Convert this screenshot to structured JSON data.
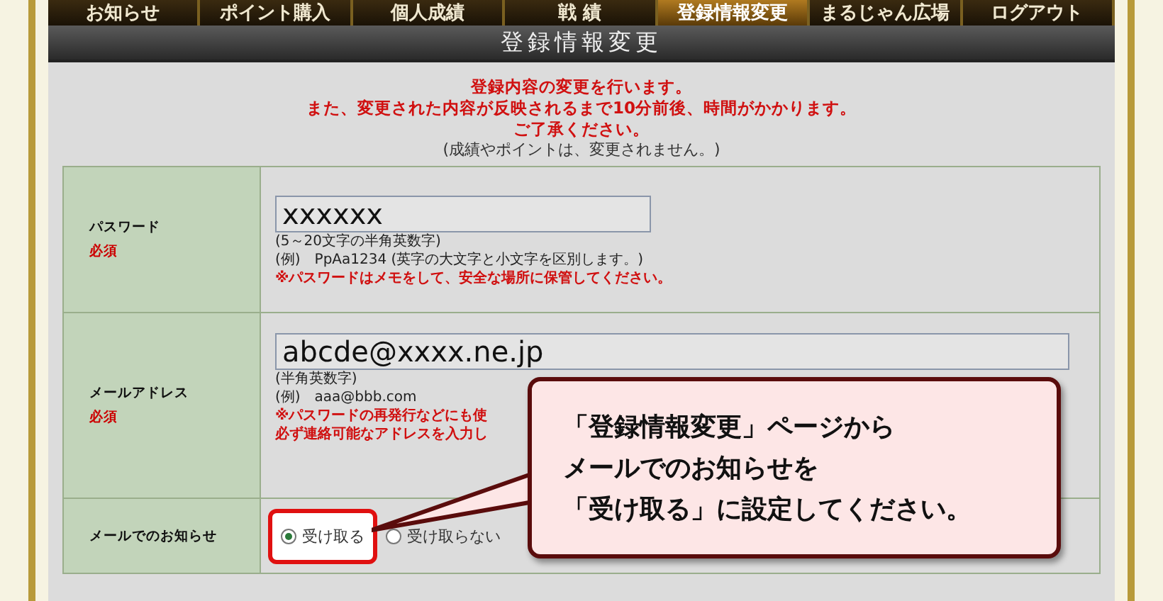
{
  "nav": [
    {
      "label": "お知らせ",
      "selected": false
    },
    {
      "label": "ポイント購入",
      "selected": false
    },
    {
      "label": "個人成績",
      "selected": false
    },
    {
      "label": "戦 績",
      "selected": false
    },
    {
      "label": "登録情報変更",
      "selected": true
    },
    {
      "label": "まるじゃん広場",
      "selected": false
    },
    {
      "label": "ログアウト",
      "selected": false
    }
  ],
  "page_title": "登録情報変更",
  "notice": {
    "lines": [
      "登録内容の変更を行います。",
      "また、変更された内容が反映されるまで10分前後、時間がかかります。",
      "ご了承ください。"
    ],
    "note": "(成績やポイントは、変更されません。)"
  },
  "form": [
    {
      "kind": "text",
      "label": "パスワード",
      "required": "必須",
      "value": "xxxxxx",
      "hints": [
        {
          "text": "(5～20文字の半角英数字)",
          "warning": false
        },
        {
          "text": "(例)　PpAa1234 (英字の大文字と小文字を区別します。)",
          "warning": false
        },
        {
          "text": "※パスワードはメモをして、安全な場所に保管してください。",
          "warning": true
        }
      ]
    },
    {
      "kind": "text",
      "label": "メールアドレス",
      "required": "必須",
      "value": "abcde@xxxx.ne.jp",
      "hints": [
        {
          "text": "(半角英数字)",
          "warning": false
        },
        {
          "text": "(例)　aaa@bbb.com",
          "warning": false
        },
        {
          "text": "※パスワードの再発行などにも使",
          "warning": true
        },
        {
          "text": "必ず連絡可能なアドレスを入力し",
          "warning": true
        }
      ]
    },
    {
      "kind": "radio",
      "label": "メールでのお知らせ",
      "options": [
        {
          "label": "受け取る",
          "selected": true,
          "highlighted": true
        },
        {
          "label": "受け取らない",
          "selected": false,
          "highlighted": false
        }
      ]
    }
  ],
  "callout": {
    "lines": [
      "「登録情報変更」ページから",
      "メールでのお知らせを",
      "「受け取る」に設定してください。"
    ]
  }
}
